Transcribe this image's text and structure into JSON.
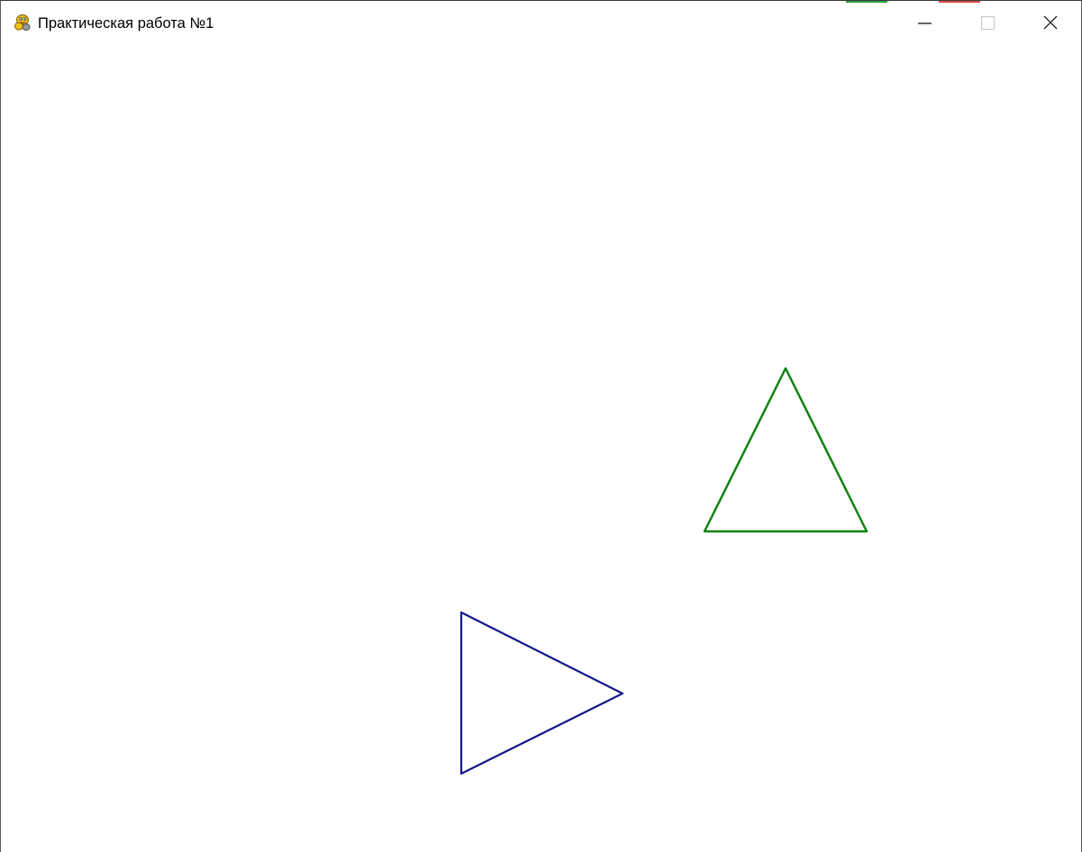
{
  "window": {
    "title": "Практическая работа №1",
    "app_icon": "pygame-snake-icon",
    "controls": {
      "minimize_icon": "minimize-icon",
      "maximize_icon": "maximize-icon",
      "close_icon": "close-icon"
    },
    "accent_colors": {
      "green": "#2e9e3a",
      "red": "#d94a4a"
    }
  },
  "canvas": {
    "background": "#ffffff",
    "shapes": [
      {
        "name": "green-triangle",
        "type": "triangle",
        "orientation": "pointing-up",
        "stroke": "#118211"
      },
      {
        "name": "blue-triangle",
        "type": "triangle",
        "orientation": "pointing-right",
        "stroke": "#17178a"
      }
    ]
  }
}
